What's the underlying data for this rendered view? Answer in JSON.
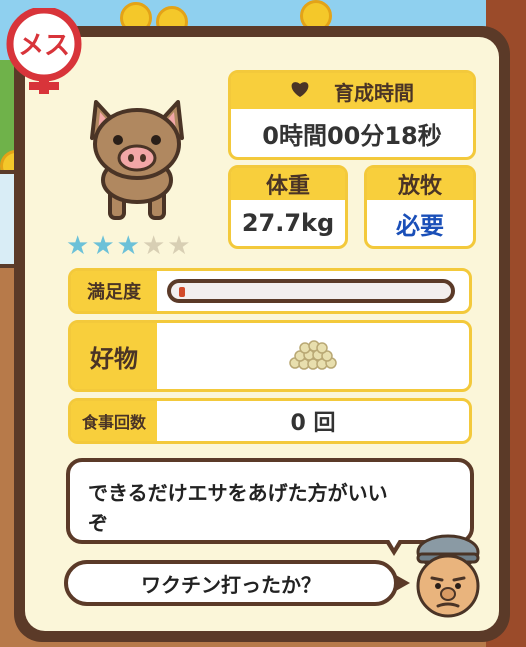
{
  "gender": {
    "label": "メス",
    "color": "#d8343a"
  },
  "stars": {
    "filled": 3,
    "total": 5,
    "filled_color": "#6cc1d8",
    "empty_color": "#d8cfb4"
  },
  "raising_time": {
    "label": "育成時間",
    "value": "0時間00分18秒"
  },
  "weight": {
    "label": "体重",
    "value": "27.7kg"
  },
  "grazing": {
    "label": "放牧",
    "value": "必要"
  },
  "satisfaction": {
    "label": "満足度",
    "level": 0.02
  },
  "favorite": {
    "label": "好物",
    "item_icon": "feed-pellets-icon"
  },
  "meals": {
    "label": "食事回数",
    "value": "0 回"
  },
  "dialogue": {
    "line1": "できるだけエサをあげた方がいい\nぞ",
    "line2": "ワクチン打ったか？"
  }
}
